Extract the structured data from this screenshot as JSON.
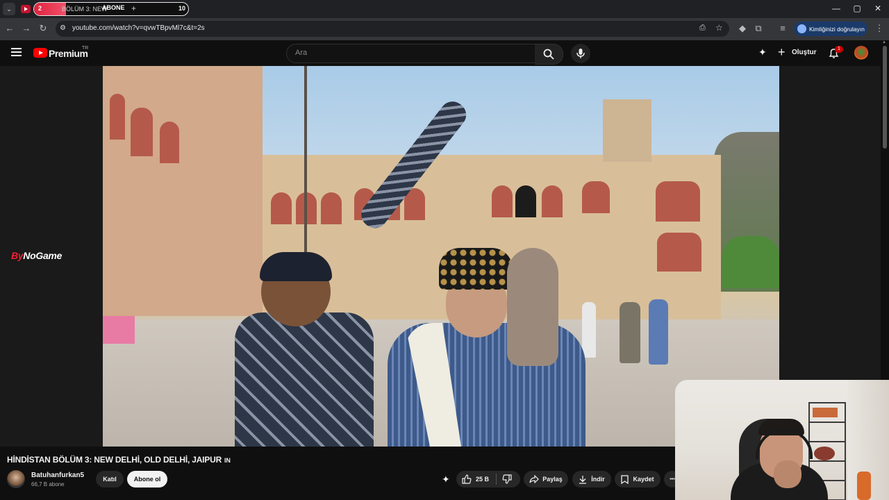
{
  "tab": {
    "count": "2",
    "title": "BÖLÜM 3: NEW",
    "abone_label": "ABONE",
    "plus": "+",
    "number": "10"
  },
  "window_controls": {
    "minimize": "—",
    "maximize": "▢",
    "close": "✕"
  },
  "address_bar": {
    "url": "youtube.com/watch?v=qvwTBpvMl7c&t=2s",
    "verify_label": "Kimliğinizi doğrulayın"
  },
  "masthead": {
    "brand": "Premium",
    "country": "TR",
    "search_placeholder": "Ara",
    "create_label": "Oluştur",
    "notification_count": "1"
  },
  "player": {
    "watermark_prefix": "By",
    "watermark_suffix": "NoGame"
  },
  "video": {
    "title": "HİNDİSTAN BÖLÜM 3: NEW DELHİ, OLD DELHİ, JAIPUR",
    "title_flag": "IN"
  },
  "channel": {
    "name": "Batuhanfurkan5",
    "subscribers": "66,7 B abone",
    "join_label": "Katıl",
    "subscribe_label": "Abone ol"
  },
  "actions": {
    "likes": "25 B",
    "share_label": "Paylaş",
    "download_label": "İndir",
    "save_label": "Kaydet",
    "more": "•••"
  },
  "colors": {
    "youtube_red": "#ff0000",
    "accent": "#e0233e",
    "background": "#0f0f0f"
  }
}
